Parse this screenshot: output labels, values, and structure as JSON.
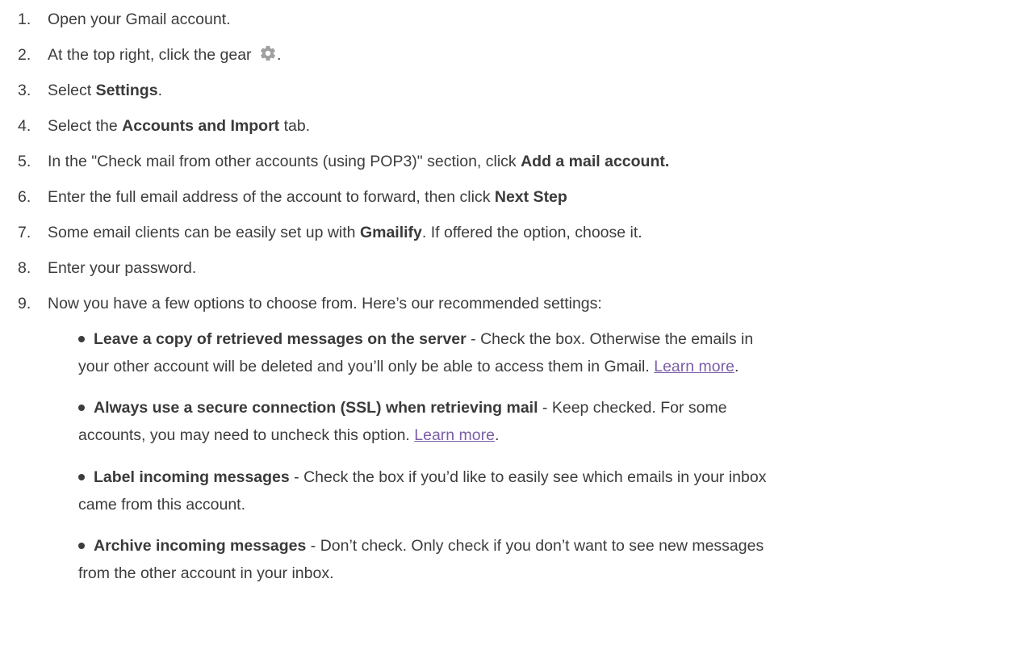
{
  "steps": [
    {
      "num": "1.",
      "text": "Open your Gmail account."
    },
    {
      "num": "2.",
      "pre": "At the top right, click the gear ",
      "icon": "gear-icon",
      "post": "."
    },
    {
      "num": "3.",
      "pre": "Select ",
      "bold": "Settings",
      "post": "."
    },
    {
      "num": "4.",
      "pre": "Select the ",
      "bold": "Accounts and Import",
      "post": " tab."
    },
    {
      "num": "5.",
      "pre": "In the \"Check mail from other accounts (using POP3)\" section, click ",
      "bold": "Add a mail account.",
      "post": ""
    },
    {
      "num": "6.",
      "pre": "Enter the full email address of the account to forward, then click ",
      "bold": "Next Step",
      "post": ""
    },
    {
      "num": "7.",
      "pre": "Some email clients can be easily set up with ",
      "bold": "Gmailify",
      "post": ". If offered the option, choose it."
    },
    {
      "num": "8.",
      "text": "Enter your password."
    },
    {
      "num": "9.",
      "text": "Now you have a few options to choose from. Here’s our recommended settings:"
    }
  ],
  "bullets": [
    {
      "bold": "Leave a copy of retrieved messages on the server",
      "line1_rest": " - Check the box. Otherwise the emails in",
      "line2": "your other account will be deleted and you’ll only be able to access them in Gmail. ",
      "link": "Learn more",
      "line2_end": "."
    },
    {
      "bold": "Always use a secure connection (SSL) when retrieving mail",
      "line1_rest": " - Keep checked. For some",
      "line2": "accounts, you may need to uncheck this option. ",
      "link": "Learn more",
      "line2_end": "."
    },
    {
      "bold": "Label incoming messages",
      "line1_rest": " - Check the box if you’d like to easily see which emails in your inbox",
      "line2": "came from this account."
    },
    {
      "bold": "Archive incoming messages",
      "line1_rest": " - Don’t check. Only check if you don’t want to see new messages",
      "line2": "from the other account in your inbox."
    }
  ],
  "colors": {
    "text": "#3c3c3c",
    "link": "#7b5ea7",
    "icon": "#9a9a9a"
  }
}
